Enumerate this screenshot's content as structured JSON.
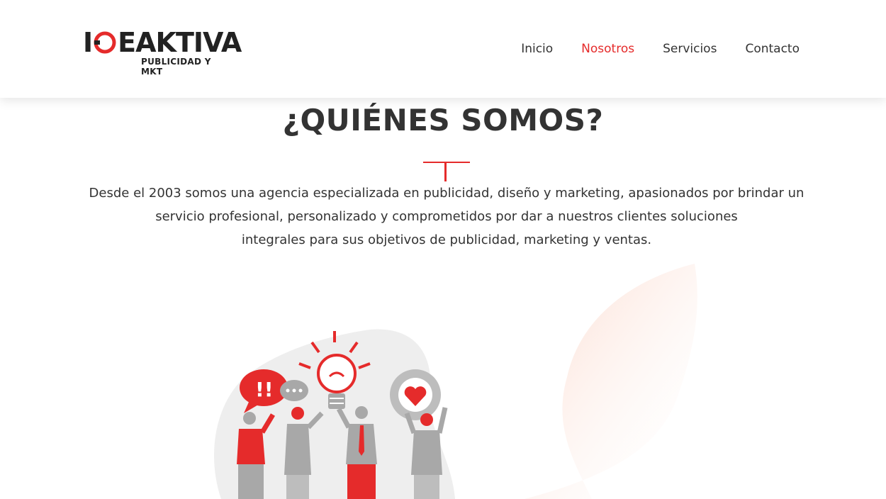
{
  "header": {
    "logo": {
      "word": "IDEAKTIVA",
      "tagline": "PUBLICIDAD Y MKT"
    },
    "nav": [
      {
        "label": "Inicio",
        "active": false
      },
      {
        "label": "Nosotros",
        "active": true
      },
      {
        "label": "Servicios",
        "active": false
      },
      {
        "label": "Contacto",
        "active": false
      }
    ]
  },
  "main": {
    "title": "¿QUIÉNES SOMOS?",
    "description": [
      "Desde el 2003 somos una agencia especializada en publicidad, diseño y marketing, apasionados por brindar un",
      "servicio profesional, personalizado y comprometidos por dar a nuestros clientes soluciones",
      "integrales para sus objetivos de publicidad, marketing y ventas."
    ]
  },
  "illustration": {
    "speech_bubble_text": "!!",
    "icons": [
      "speech-bubble-icon",
      "lightbulb-icon",
      "heart-icon"
    ]
  },
  "colors": {
    "accent": "#e52b2b",
    "text": "#333333",
    "grey": "#a8a8a8"
  }
}
